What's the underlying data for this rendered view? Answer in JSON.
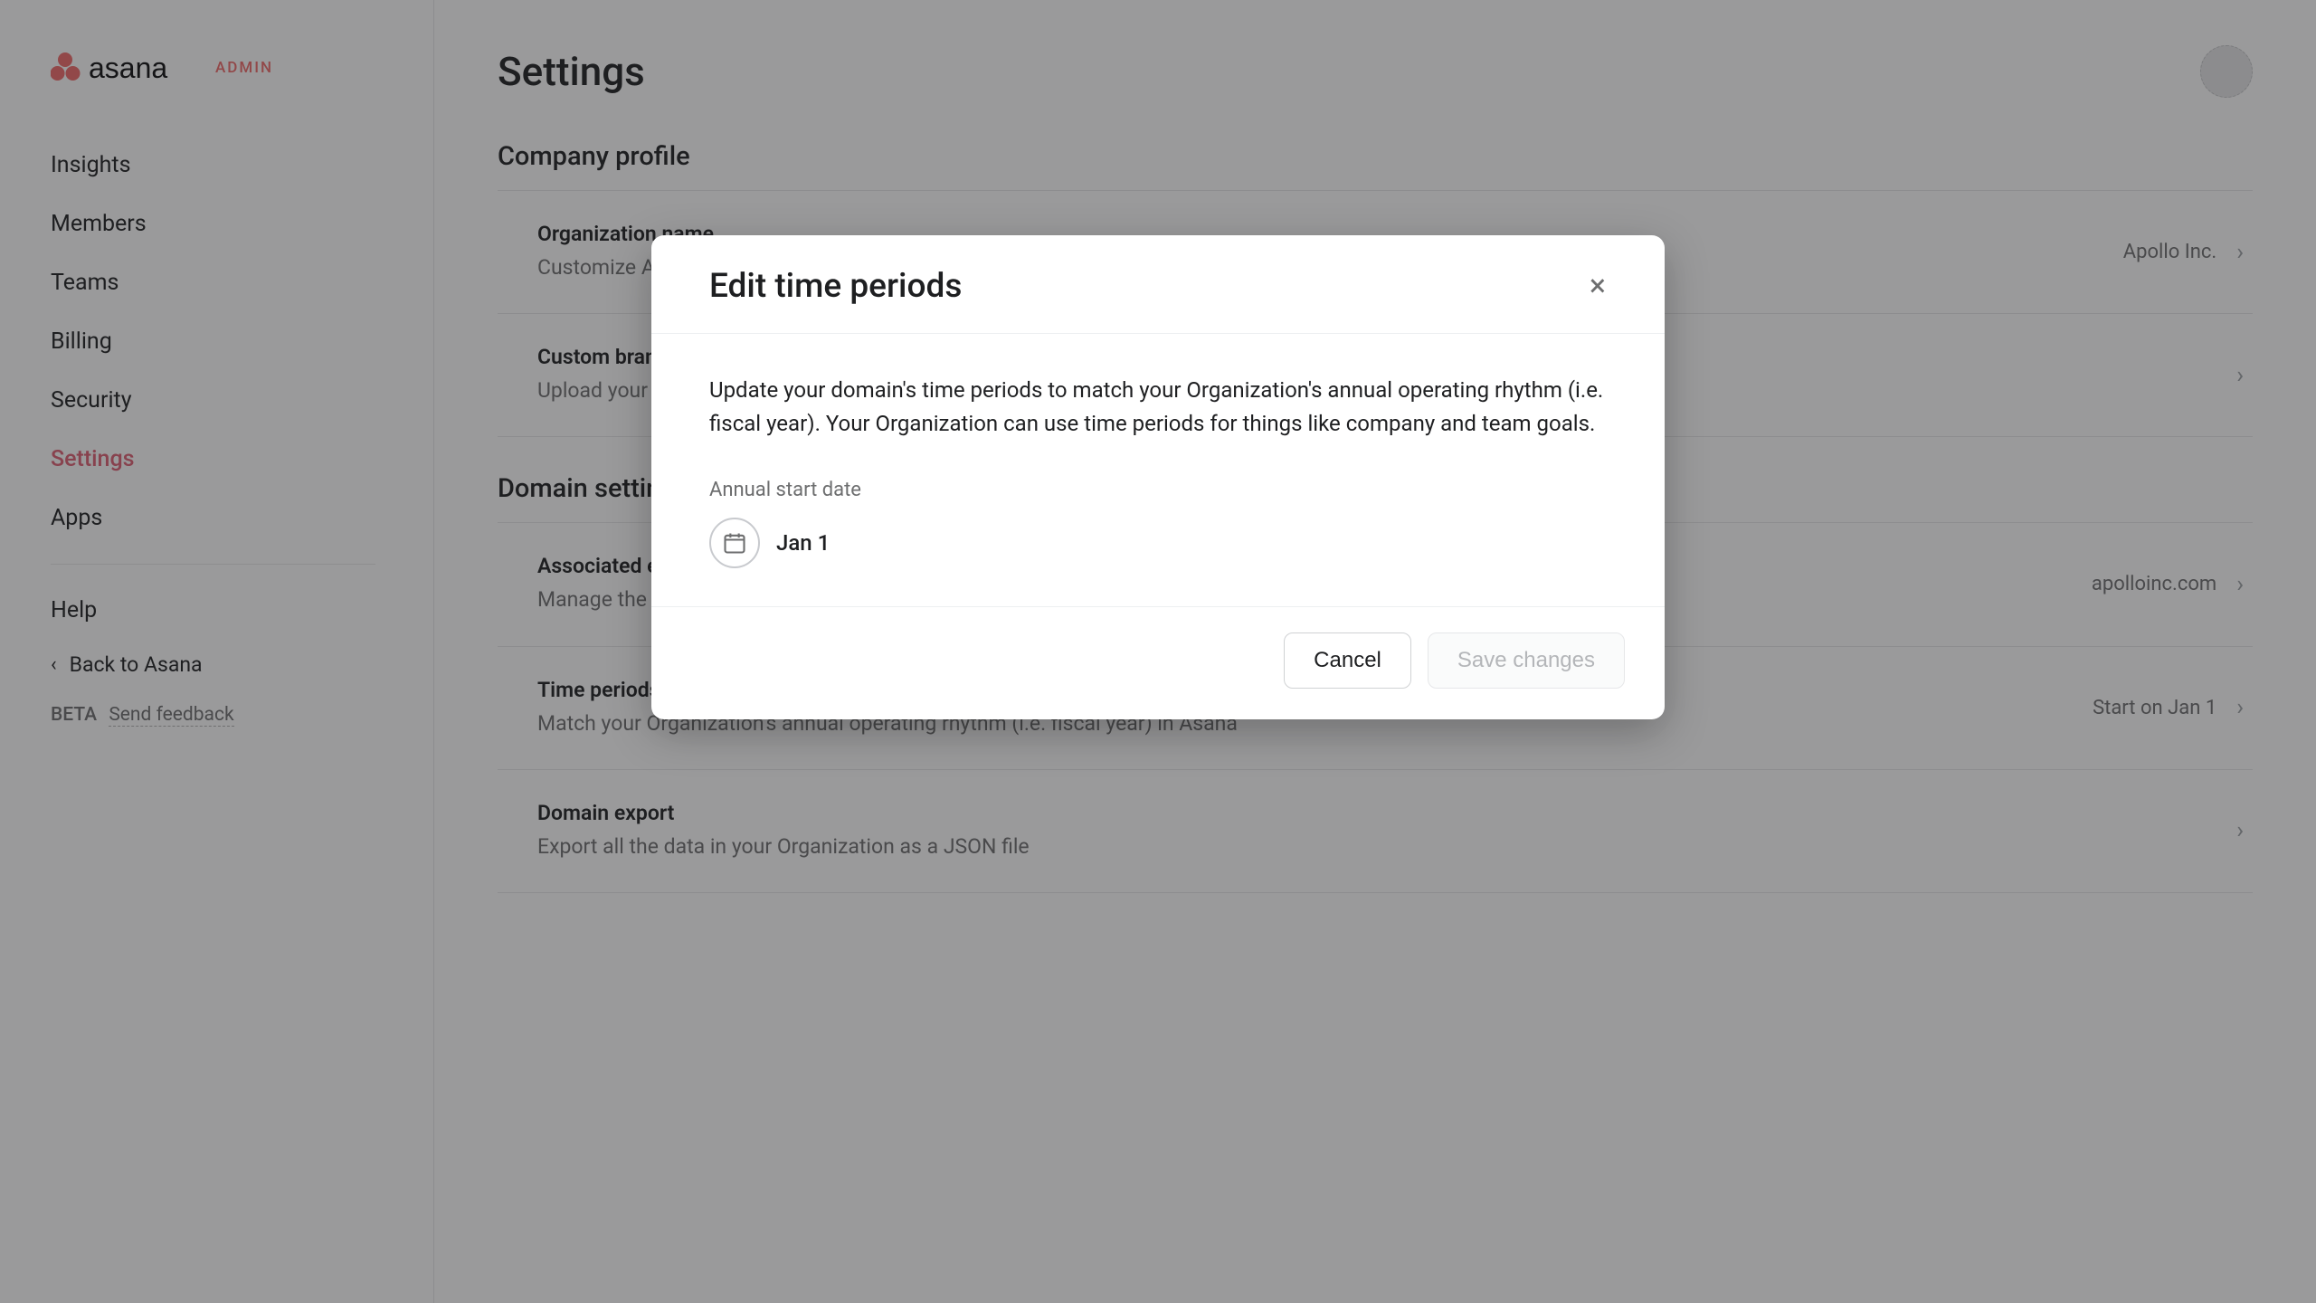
{
  "brand": {
    "admin_tag": "ADMIN"
  },
  "sidebar": {
    "items": [
      {
        "label": "Insights"
      },
      {
        "label": "Members"
      },
      {
        "label": "Teams"
      },
      {
        "label": "Billing"
      },
      {
        "label": "Security"
      },
      {
        "label": "Settings"
      },
      {
        "label": "Apps"
      }
    ],
    "help_label": "Help",
    "back_label": "Back to Asana",
    "beta_label": "BETA",
    "feedback_label": "Send feedback"
  },
  "header": {
    "title": "Settings"
  },
  "sections": [
    {
      "title": "Company profile",
      "rows": [
        {
          "title": "Organization name",
          "desc": "Customize Asana by changing your organization's name",
          "value": "Apollo Inc."
        },
        {
          "title": "Custom branding",
          "desc": "Upload your company's logo for a branded Asana experience",
          "value": ""
        }
      ]
    },
    {
      "title": "Domain settings",
      "rows": [
        {
          "title": "Associated email domains",
          "desc": "Manage the email domains that are allowed to join your Organization",
          "value": "apolloinc.com"
        },
        {
          "title": "Time periods",
          "desc": "Match your Organization's annual operating rhythm (i.e. fiscal year) in Asana",
          "value": "Start on Jan 1"
        },
        {
          "title": "Domain export",
          "desc": "Export all the data in your Organization as a JSON file",
          "value": ""
        }
      ]
    }
  ],
  "modal": {
    "title": "Edit time periods",
    "description": "Update your domain's time periods to match your Organization's annual operating rhythm (i.e. fiscal year). Your Organization can use time periods for things like company and team goals.",
    "field_label": "Annual start date",
    "date_value": "Jan 1",
    "cancel_label": "Cancel",
    "save_label": "Save changes"
  },
  "colors": {
    "accent": "#f06a6a",
    "active_nav": "#de5f73"
  }
}
